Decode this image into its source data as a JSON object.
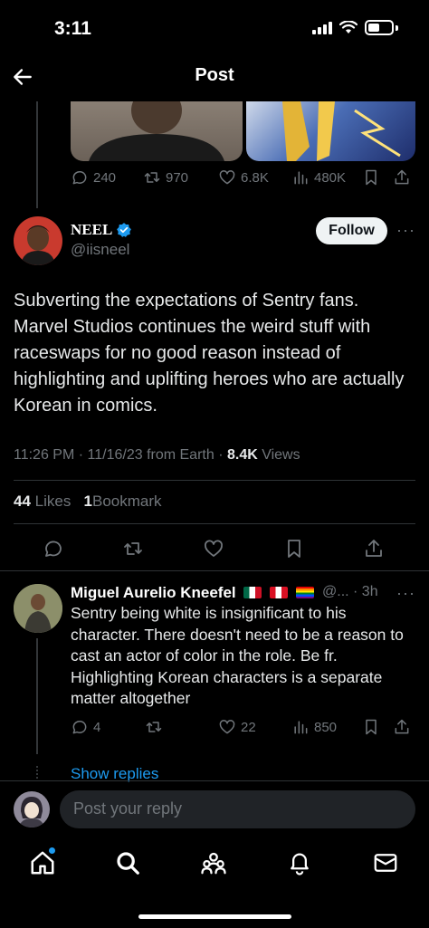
{
  "status_bar": {
    "time": "3:11"
  },
  "header": {
    "title": "Post"
  },
  "quoted_actions": {
    "replies": "240",
    "reposts": "970",
    "likes": "6.8K",
    "views": "480K"
  },
  "post": {
    "author_name": "NEEL",
    "author_handle": "@iisneel",
    "follow_label": "Follow",
    "text": "Subverting the expectations of Sentry fans. Marvel Studios continues the weird stuff with raceswaps for no good reason instead of highlighting and uplifting heroes who are actually Korean in comics.",
    "time": "11:26 PM",
    "date": "11/16/23",
    "source": "from Earth",
    "views_count": "8.4K",
    "views_label": "Views",
    "likes_count": "44",
    "likes_label": "Likes",
    "bookmarks_count": "1",
    "bookmarks_label": "Bookmark"
  },
  "reply": {
    "author_name": "Miguel Aurelio Kneefel",
    "handle_time": "@... · 3h",
    "text": "Sentry being white is insignificant to his character. There doesn't need to be a reason to cast an actor of color in the role. Be fr. Highlighting Korean characters is a separate matter altogether",
    "replies": "4",
    "likes": "22",
    "views": "850",
    "show_replies": "Show replies"
  },
  "compose": {
    "placeholder": "Post your reply"
  },
  "colors": {
    "accent": "#1d9bf0",
    "background": "#000000",
    "muted": "#71767b"
  },
  "icons": [
    "back-arrow-icon",
    "reply-icon",
    "repost-icon",
    "like-icon",
    "views-icon",
    "bookmark-icon",
    "share-icon",
    "verified-icon",
    "more-icon",
    "home-icon",
    "search-icon",
    "communities-icon",
    "notifications-icon",
    "messages-icon"
  ]
}
